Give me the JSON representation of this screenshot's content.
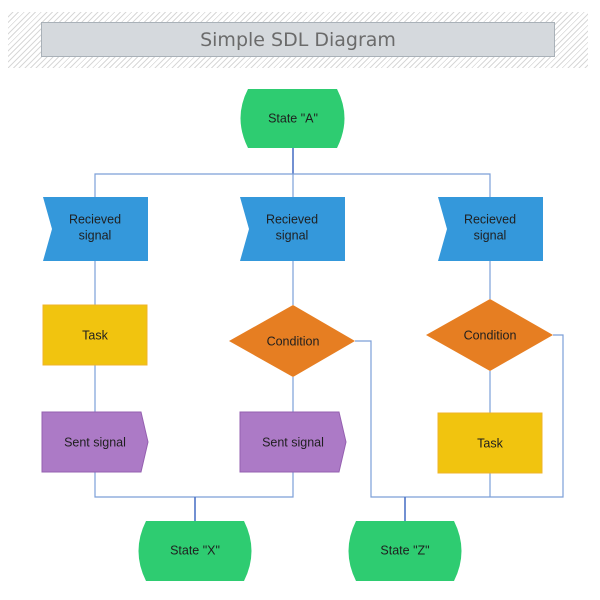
{
  "title": "Simple SDL Diagram",
  "colors": {
    "state": "#2ecc71",
    "received_signal": "#3498db",
    "task": "#f1c40f",
    "condition": "#e67e22",
    "sent_signal": "#ac7ac6",
    "connector": "#7c9fd8"
  },
  "nodes": {
    "state_a": {
      "label": "State \"A\"",
      "type": "state"
    },
    "recv_1": {
      "label_line1": "Recieved",
      "label_line2": "signal",
      "type": "received-signal"
    },
    "recv_2": {
      "label_line1": "Recieved",
      "label_line2": "signal",
      "type": "received-signal"
    },
    "recv_3": {
      "label_line1": "Recieved",
      "label_line2": "signal",
      "type": "received-signal"
    },
    "task_1": {
      "label": "Task",
      "type": "task"
    },
    "cond_2": {
      "label": "Condition",
      "type": "condition"
    },
    "cond_3": {
      "label": "Condition",
      "type": "condition"
    },
    "sent_1": {
      "label": "Sent signal",
      "type": "sent-signal"
    },
    "sent_2": {
      "label": "Sent signal",
      "type": "sent-signal"
    },
    "task_3": {
      "label": "Task",
      "type": "task"
    },
    "state_x": {
      "label": "State \"X\"",
      "type": "state"
    },
    "state_z": {
      "label": "State \"Z\"",
      "type": "state"
    }
  },
  "edges": [
    {
      "from": "state_a",
      "to": "recv_1"
    },
    {
      "from": "state_a",
      "to": "recv_2"
    },
    {
      "from": "state_a",
      "to": "recv_3"
    },
    {
      "from": "recv_1",
      "to": "task_1"
    },
    {
      "from": "task_1",
      "to": "sent_1"
    },
    {
      "from": "recv_2",
      "to": "cond_2"
    },
    {
      "from": "cond_2",
      "to": "sent_2"
    },
    {
      "from": "cond_2",
      "to": "state_z"
    },
    {
      "from": "recv_3",
      "to": "cond_3"
    },
    {
      "from": "cond_3",
      "to": "task_3"
    },
    {
      "from": "cond_3",
      "to": "state_z"
    },
    {
      "from": "sent_1",
      "to": "state_x"
    },
    {
      "from": "sent_2",
      "to": "state_x"
    },
    {
      "from": "task_3",
      "to": "state_z"
    }
  ]
}
